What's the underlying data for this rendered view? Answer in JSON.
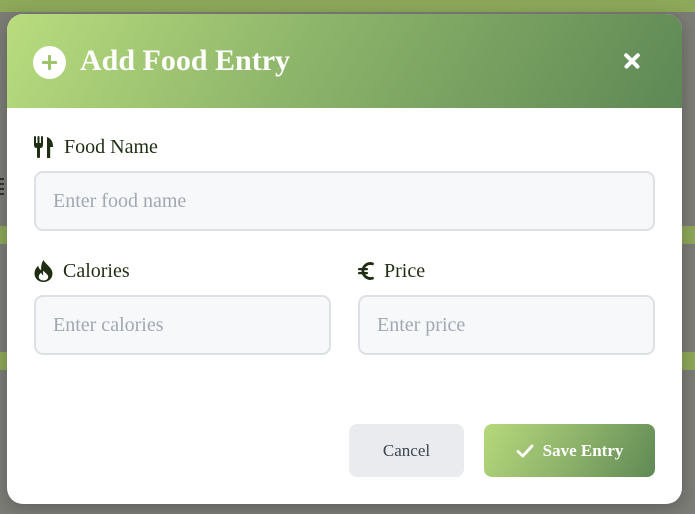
{
  "colors": {
    "header_gradient_start": "#b9dc7e",
    "header_gradient_end": "#5e8855",
    "label_text": "#1f2e12",
    "input_background": "#f7f8fa",
    "input_border": "#dde0e4",
    "cancel_background": "#e9ebee"
  },
  "modal": {
    "title": "Add Food Entry",
    "header_icon": "plus-circle-icon",
    "close_icon": "close-icon"
  },
  "fields": {
    "food_name": {
      "label": "Food Name",
      "icon": "utensils-icon",
      "placeholder": "Enter food name",
      "value": ""
    },
    "calories": {
      "label": "Calories",
      "icon": "fire-icon",
      "placeholder": "Enter calories",
      "value": ""
    },
    "price": {
      "label": "Price",
      "icon": "euro-icon",
      "placeholder": "Enter price",
      "value": ""
    }
  },
  "actions": {
    "cancel_label": "Cancel",
    "save_label": "Save Entry",
    "save_icon": "check-icon"
  }
}
